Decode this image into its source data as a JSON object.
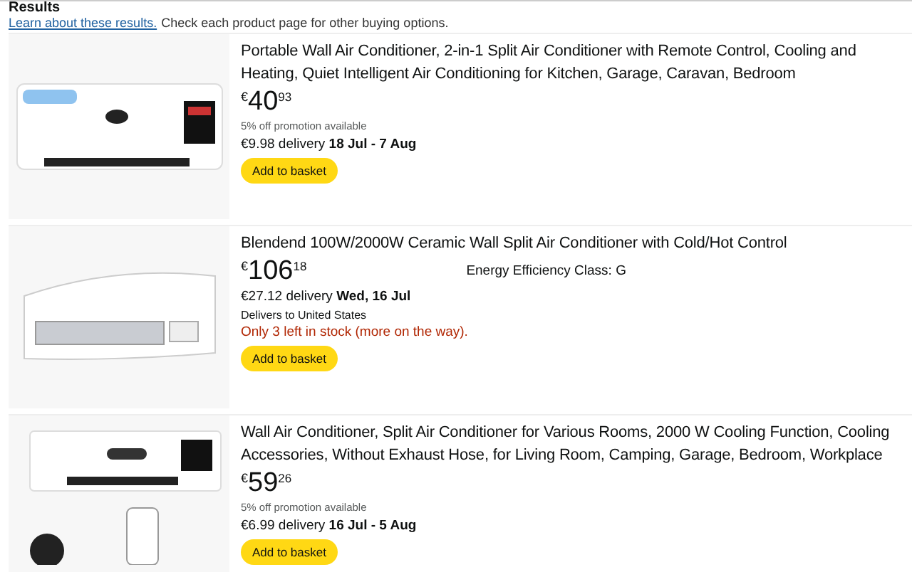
{
  "heading": "Results",
  "notice": {
    "link": "Learn about these results.",
    "text": "Check each product page for other buying options."
  },
  "products": [
    {
      "kind": "panel",
      "title": "Portable Wall Air Conditioner, 2-in-1 Split Air Conditioner with Remote Control, Cooling and Heating, Quiet Intelligent Air Conditioning for Kitchen, Garage, Caravan, Bedroom",
      "currency": "€",
      "price_whole": "40",
      "price_fraction": "93",
      "promotion": "5% off promotion available",
      "delivery_price": "€9.98 delivery",
      "delivery_date": "18 Jul - 7 Aug",
      "button": "Add to basket"
    },
    {
      "kind": "curved",
      "title": "Blendend 100W/2000W Ceramic Wall Split Air Conditioner with Cold/Hot Control",
      "currency": "€",
      "price_whole": "106",
      "price_fraction": "18",
      "energy_class": "Energy Efficiency Class: G",
      "delivery_price": "€27.12 delivery",
      "delivery_date": "Wed, 16 Jul",
      "delivers_to": "Delivers to United States",
      "stock": "Only 3 left in stock (more on the way).",
      "button": "Add to basket"
    },
    {
      "kind": "remote",
      "title": "Wall Air Conditioner, Split Air Conditioner for Various Rooms, 2000 W Cooling Function, Cooling Accessories, Without Exhaust Hose, for Living Room, Camping, Garage, Bedroom, Workplace",
      "currency": "€",
      "price_whole": "59",
      "price_fraction": "26",
      "promotion": "5% off promotion available",
      "delivery_price": "€6.99 delivery",
      "delivery_date": "16 Jul - 5 Aug",
      "button": "Add to basket"
    }
  ]
}
